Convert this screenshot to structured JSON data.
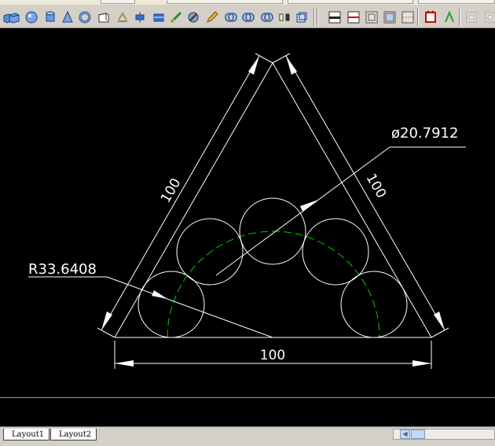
{
  "toolbar": {
    "icons": [
      "box-icon",
      "sphere-icon",
      "cylinder-icon",
      "cone-icon",
      "torus-icon",
      "wedge-icon",
      "extrude-icon",
      "revolve-icon",
      "slice-icon",
      "section-icon",
      "interfere-icon",
      "pencil-icon",
      "union-icon",
      "subtract-icon",
      "intersect-icon",
      "separate-icon",
      "solid-edit-icon",
      "layer-1-icon",
      "layer-2-icon",
      "layer-3-icon",
      "layer-4-icon",
      "layer-5-icon",
      "red-solid-icon",
      "green-text-icon",
      "gray-1-icon",
      "gray-2-icon"
    ]
  },
  "drawing": {
    "dimensions": {
      "left_side": "100",
      "right_side": "100",
      "bottom": "100",
      "diameter": "ø20.7912",
      "radius": "R33.6408"
    },
    "colors": {
      "background": "#000000",
      "geometry": "#ffffff",
      "arc": "#00cc00"
    }
  },
  "layout_tabs": {
    "tabs": [
      "Layout1",
      "Layout2"
    ]
  }
}
